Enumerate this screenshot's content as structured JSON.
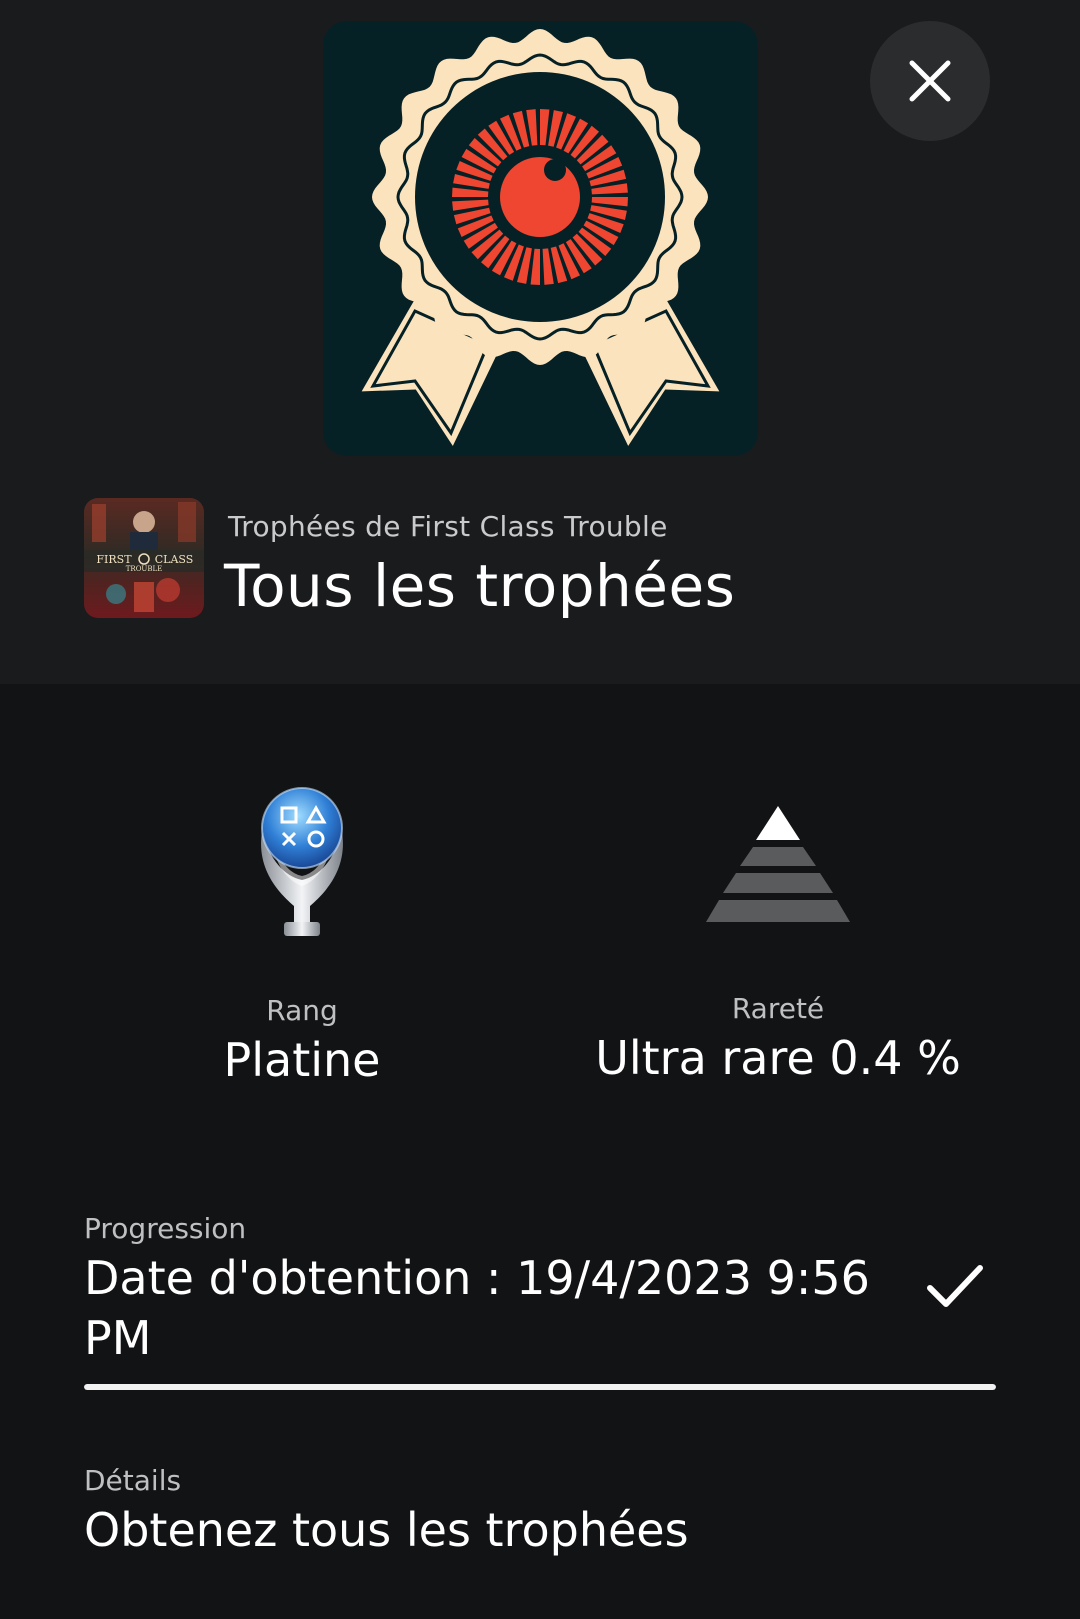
{
  "header": {
    "game_subtitle": "Trophées de First Class Trouble",
    "title": "Tous les trophées",
    "game_thumb_text": {
      "line1": "FIRST",
      "line2": "CLASS",
      "line3": "TROUBLE"
    }
  },
  "icons": {
    "trophy_art": "ribbon-medal-eye-icon",
    "close": "close-icon",
    "grade": "platinum-trophy-icon",
    "rarity": "pyramid-rarity-icon",
    "completed": "checkmark-icon"
  },
  "stats": {
    "grade_label": "Rang",
    "grade_value": "Platine",
    "rarity_label": "Rareté",
    "rarity_value": "Ultra rare 0.4 %"
  },
  "progress": {
    "label": "Progression",
    "text": "Date d'obtention : 19/4/2023  9:56 PM",
    "percent": 100
  },
  "details": {
    "label": "Détails",
    "text": "Obtenez tous les trophées"
  },
  "colors": {
    "background": "#121315",
    "header_background": "#1a1b1d",
    "art_background": "#062126",
    "art_cream": "#fbe3bd",
    "art_red": "#ee4631",
    "progress_fill": "#f2f2f2"
  }
}
